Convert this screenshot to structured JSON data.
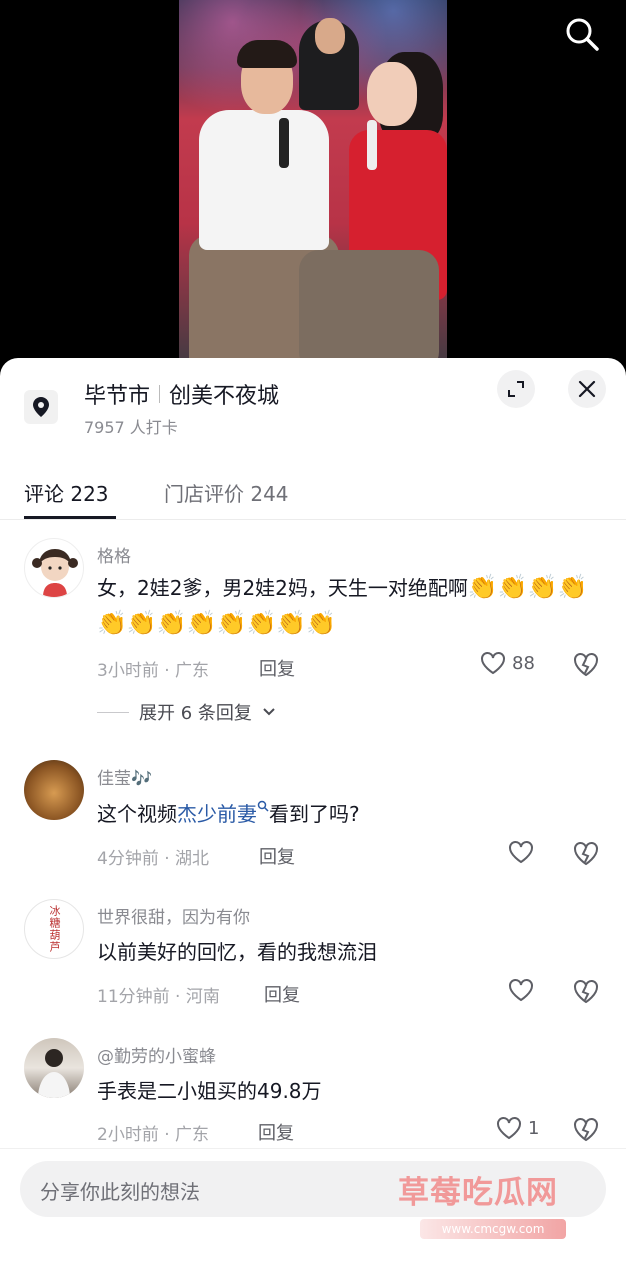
{
  "location": {
    "city": "毕节市",
    "place": "创美不夜城",
    "checkins": "7957 人打卡"
  },
  "tabs": {
    "comments": "评论 223",
    "reviews": "门店评价 244"
  },
  "comments": [
    {
      "username": "格格",
      "text": "女，2娃2爹，男2娃2妈，天生一对绝配啊",
      "claps": [
        "👏",
        "👏",
        "👏",
        "👏",
        "👏",
        "👏",
        "👏",
        "👏",
        "👏",
        "👏",
        "👏",
        "👏"
      ],
      "meta": "3小时前 · 广东",
      "reply_label": "回复",
      "likes": "88",
      "expand_label": "展开 6 条回复"
    },
    {
      "username": "佳莹🎶",
      "text_before": "这个视频",
      "text_link": "杰少前妻",
      "text_after": "看到了吗?",
      "meta": "4分钟前 · 湖北",
      "reply_label": "回复"
    },
    {
      "username": "世界很甜，因为有你",
      "text": "以前美好的回忆，看的我想流泪",
      "meta": "11分钟前 · 河南",
      "reply_label": "回复",
      "avatar_text": "冰糖葫芦"
    },
    {
      "username": "@勤劳的小蜜蜂",
      "text": "手表是二小姐买的49.8万",
      "meta": "2小时前 · 广东",
      "reply_label": "回复",
      "likes": "1"
    }
  ],
  "input": {
    "placeholder": "分享你此刻的想法"
  },
  "watermark": {
    "text": "草莓吃瓜网",
    "url": "www.cmcgw.com"
  },
  "colors": {
    "link": "#2a5aa6",
    "watermark": "#f18a8a"
  },
  "icons": [
    "search-icon",
    "location-pin-icon",
    "expand-icon",
    "close-icon",
    "heart-icon",
    "broken-heart-icon",
    "chevron-down-icon"
  ]
}
